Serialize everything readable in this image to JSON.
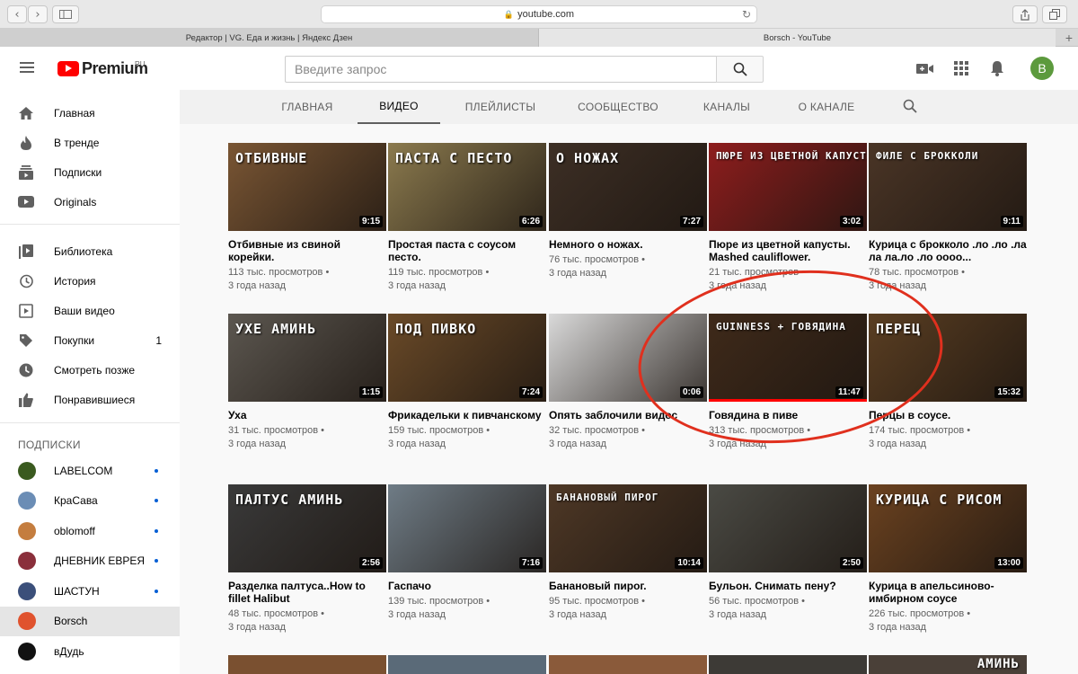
{
  "browser": {
    "url": "youtube.com",
    "tabs": [
      {
        "title": "Редактор | VG. Еда и жизнь | Яндекс Дзен"
      },
      {
        "title": "Borsch - YouTube"
      }
    ]
  },
  "header": {
    "logo_text": "Premium",
    "region": "RU",
    "search_placeholder": "Введите запрос",
    "avatar_letter": "B"
  },
  "sidebar": {
    "main": [
      {
        "label": "Главная",
        "icon": "home-icon"
      },
      {
        "label": "В тренде",
        "icon": "trending-icon"
      },
      {
        "label": "Подписки",
        "icon": "subscriptions-icon"
      },
      {
        "label": "Originals",
        "icon": "originals-icon"
      }
    ],
    "library": [
      {
        "label": "Библиотека",
        "icon": "library-icon",
        "count": ""
      },
      {
        "label": "История",
        "icon": "history-icon",
        "count": ""
      },
      {
        "label": "Ваши видео",
        "icon": "your-videos-icon",
        "count": ""
      },
      {
        "label": "Покупки",
        "icon": "purchases-icon",
        "count": "1"
      },
      {
        "label": "Смотреть позже",
        "icon": "watch-later-icon",
        "count": ""
      },
      {
        "label": "Понравившиеся",
        "icon": "liked-icon",
        "count": ""
      }
    ],
    "subscriptions_heading": "ПОДПИСКИ",
    "subscriptions": [
      {
        "label": "LABELCOM",
        "color": "#3a5a1f",
        "dot": true
      },
      {
        "label": "КраСава",
        "color": "#6b8db5",
        "dot": true
      },
      {
        "label": "oblomoff",
        "color": "#c47d3f",
        "dot": true
      },
      {
        "label": "ДНЕВНИК ЕВРЕЯ",
        "color": "#8a2f3b",
        "dot": true
      },
      {
        "label": "ШАСТУН",
        "color": "#3b4f7a",
        "dot": true
      },
      {
        "label": "Borsch",
        "color": "#e0532e",
        "dot": false
      },
      {
        "label": "вДудь",
        "color": "#111111",
        "dot": false
      }
    ]
  },
  "channel_tabs": [
    "ГЛАВНАЯ",
    "ВИДЕО",
    "ПЛЕЙЛИСТЫ",
    "СООБЩЕСТВО",
    "КАНАЛЫ",
    "О КАНАЛЕ"
  ],
  "videos": [
    {
      "title": "Отбивные из свиной корейки.",
      "views": "113 тыс. просмотров",
      "age": "3 года назад",
      "duration": "9:15",
      "overlay": "ОТБИВНЫЕ",
      "bg": "#7a5634"
    },
    {
      "title": "Простая паста с соусом песто.",
      "views": "119 тыс. просмотров",
      "age": "3 года назад",
      "duration": "6:26",
      "overlay": "ПАСТА С ПЕСТО",
      "bg": "#8b7a4e"
    },
    {
      "title": "Немного о ножах.",
      "views": "76 тыс. просмотров",
      "age": "3 года назад",
      "duration": "7:27",
      "overlay": "О НОЖАХ",
      "bg": "#3d2f25"
    },
    {
      "title": "Пюре из цветной капусты. Mashed cauliflower.",
      "views": "21 тыс. просмотров",
      "age": "3 года назад",
      "duration": "3:02",
      "overlay": "ПЮРЕ ИЗ ЦВЕТНОЙ КАПУСТЫ",
      "bg": "#8e1d1d"
    },
    {
      "title": "Курица с брокколо .ло .ло .ла ла ла.ло .ло оооо...",
      "views": "78 тыс. просмотров",
      "age": "3 года назад",
      "duration": "9:11",
      "overlay": "ФИЛЕ С БРОККОЛИ",
      "bg": "#4a3526"
    },
    {
      "title": "Уха",
      "views": "31 тыс. просмотров",
      "age": "3 года назад",
      "duration": "1:15",
      "overlay": "УХЕ АМИНЬ",
      "bg": "#5c5750"
    },
    {
      "title": "Фрикадельки к пивчанскому",
      "views": "159 тыс. просмотров",
      "age": "3 года назад",
      "duration": "7:24",
      "overlay": "ПОД ПИВКО",
      "bg": "#6a4a28"
    },
    {
      "title": "Опять заблочили видос",
      "views": "32 тыс. просмотров",
      "age": "3 года назад",
      "duration": "0:06",
      "overlay": "",
      "bg": "#d9d9d9"
    },
    {
      "title": "Говядина в пиве",
      "views": "313 тыс. просмотров",
      "age": "3 года назад",
      "duration": "11:47",
      "overlay": "GUINNESS + ГОВЯДИНА",
      "bg": "#3f2a1a",
      "progress": true
    },
    {
      "title": "Перцы в соусе.",
      "views": "174 тыс. просмотров",
      "age": "3 года назад",
      "duration": "15:32",
      "overlay": "ПЕРЕЦ",
      "bg": "#5a3e22"
    },
    {
      "title": "Разделка палтуса..How to fillet Halibut",
      "views": "48 тыс. просмотров",
      "age": "3 года назад",
      "duration": "2:56",
      "overlay": "ПАЛТУС АМИНЬ",
      "bg": "#3a3a3a"
    },
    {
      "title": "Гаспачо",
      "views": "139 тыс. просмотров",
      "age": "3 года назад",
      "duration": "7:16",
      "overlay": "",
      "bg": "#6f7c86"
    },
    {
      "title": "Банановый пирог.",
      "views": "95 тыс. просмотров",
      "age": "3 года назад",
      "duration": "10:14",
      "overlay": "БАНАНОВЫЙ ПИРОГ",
      "bg": "#4e3826"
    },
    {
      "title": "Бульон. Снимать пену?",
      "views": "56 тыс. просмотров",
      "age": "3 года назад",
      "duration": "2:50",
      "overlay": "",
      "bg": "#4a4a44"
    },
    {
      "title": "Курица в апельсиново-имбирном соусе",
      "views": "226 тыс. просмотров",
      "age": "3 года назад",
      "duration": "13:00",
      "overlay": "КУРИЦА С РИСОМ",
      "bg": "#6b4220"
    }
  ],
  "bottom_row": [
    {
      "overlay": "",
      "bg": "#7a5030"
    },
    {
      "overlay": "",
      "bg": "#5a6a78"
    },
    {
      "overlay": "",
      "bg": "#8a5a3a"
    },
    {
      "overlay": "",
      "bg": "#3d3a36"
    },
    {
      "overlay": "АМИНЬ",
      "bg": "#4a4038"
    }
  ]
}
